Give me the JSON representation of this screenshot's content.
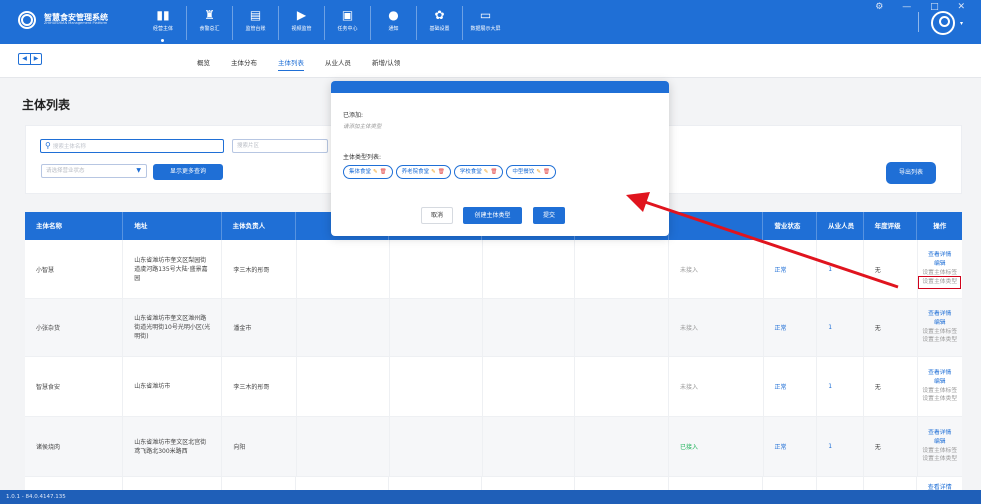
{
  "app": {
    "title": "智慧食安管理系统",
    "subtitle": "ZHIHUISHIAN Management Platform"
  },
  "topnav": [
    {
      "icon": "▮▮",
      "label": "经营主体"
    },
    {
      "icon": "♜",
      "label": "食警总汇"
    },
    {
      "icon": "▤",
      "label": "监管台账"
    },
    {
      "icon": "▶",
      "label": "视频监管"
    },
    {
      "icon": "▣",
      "label": "任务中心"
    },
    {
      "icon": "●",
      "label": "通知"
    },
    {
      "icon": "✿",
      "label": "基础设置"
    },
    {
      "icon": "▭",
      "label": "数据展示大屏"
    }
  ],
  "window_controls": "⚙ — □ ✕",
  "subnav": {
    "tabs": [
      "概览",
      "主体分布",
      "主体列表",
      "从业人员",
      "新增/认领"
    ],
    "active": "主体列表"
  },
  "page": {
    "title": "主体列表"
  },
  "filter": {
    "search_placeholder": "搜索主体名称",
    "region_placeholder": "搜索片区",
    "status_placeholder": "请选择营业状态",
    "more_button": "显示更多查询",
    "export_button": "导出列表"
  },
  "table": {
    "headers": [
      "主体名称",
      "地址",
      "主体负责人",
      "",
      "",
      "",
      "",
      "",
      "营业状态",
      "从业人员",
      "年度评级",
      "操作"
    ],
    "rows": [
      {
        "name": "小智慧",
        "address": "山东省潍坊市奎文区梨园街道虞河路135号大陆·盛景嘉园",
        "owner": "李三木的彤哥",
        "access": "未接入",
        "status": "正常",
        "staff": "1",
        "rating": "无"
      },
      {
        "name": "小张杂货",
        "address": "山东省潍坊市奎文区潍州路街道光明街10号光明小区(光明街)",
        "owner": "潘金市",
        "access": "未接入",
        "status": "正常",
        "staff": "1",
        "rating": "无"
      },
      {
        "name": "智慧食安",
        "address": "山东省潍坊市",
        "owner": "李三木的彤哥",
        "access": "未接入",
        "status": "正常",
        "staff": "1",
        "rating": "无"
      },
      {
        "name": "诸侯烧肉",
        "address": "山东省潍坊市奎文区北宫街鸢飞路北300米路西",
        "owner": "向阳",
        "access": "已接入",
        "status": "正常",
        "staff": "1",
        "rating": "无"
      }
    ],
    "ops": {
      "view": "查看详情",
      "edit": "编辑",
      "set_label": "设置主体标签",
      "set_type": "设置主体类型"
    }
  },
  "modal": {
    "added_label": "已添加:",
    "added_hint": "请添加主体类型",
    "list_label": "主体类型列表:",
    "tags": [
      "集体食堂",
      "养老院食堂",
      "学校食堂",
      "中型餐饮"
    ],
    "cancel": "取消",
    "create": "创建主体类型",
    "submit": "提交"
  },
  "footer": {
    "version": "1.0.1 - 84.0.4147.135"
  },
  "colors": {
    "primary": "#1f6fd6",
    "annotation": "#d0021b",
    "success": "#1fb35a"
  }
}
